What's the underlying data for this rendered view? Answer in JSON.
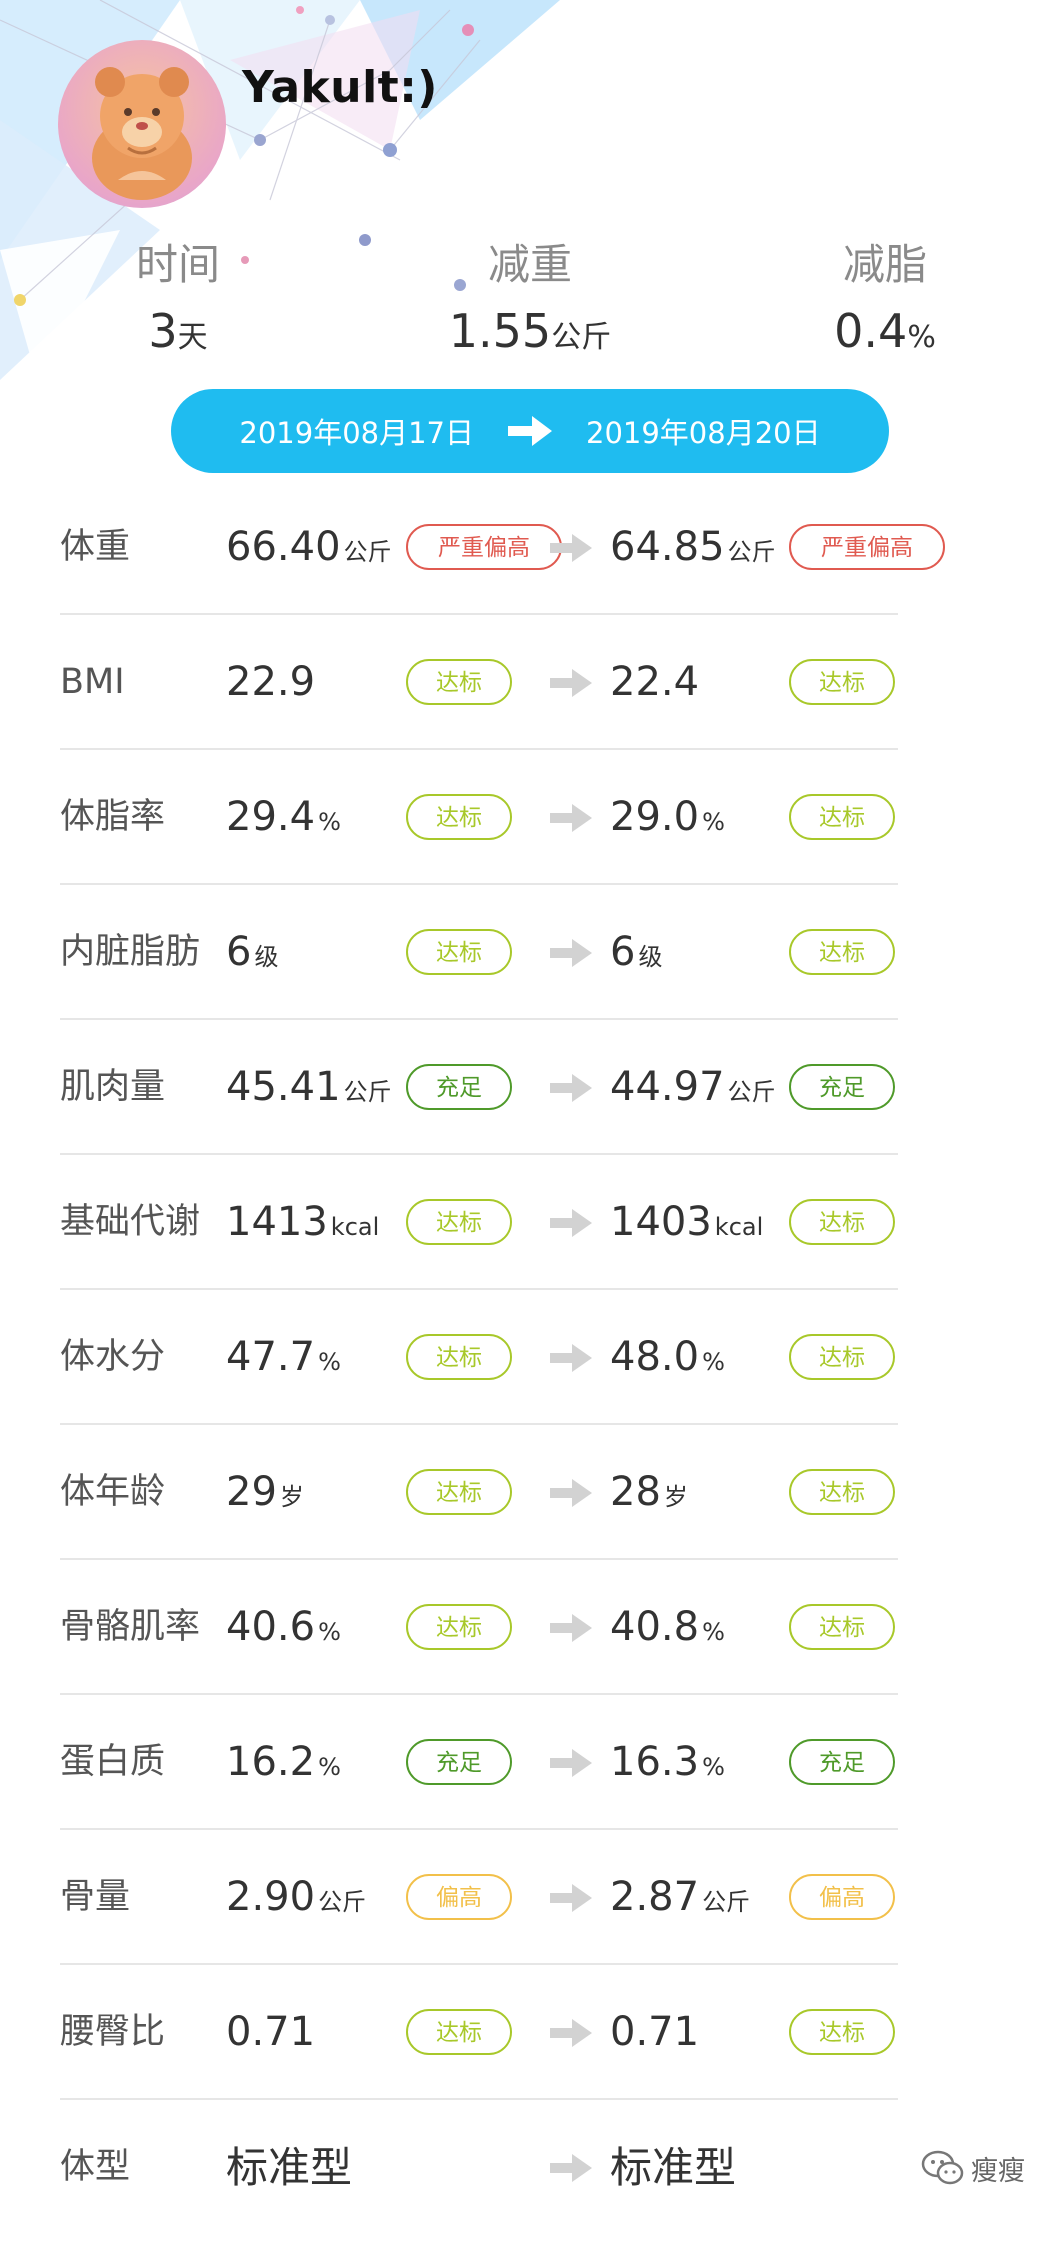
{
  "profile": {
    "username": "Yakult:)"
  },
  "summary": {
    "time_label": "时间",
    "time_value": "3",
    "time_unit": "天",
    "weight_label": "减重",
    "weight_value": "1.55",
    "weight_unit": "公斤",
    "fat_label": "减脂",
    "fat_value": "0.4",
    "fat_unit": "%"
  },
  "date_range": {
    "start": "2019年08月17日",
    "end": "2019年08月20日"
  },
  "status_colors": {
    "严重偏高": "#e05a50",
    "达标": "#a8c82a",
    "充足": "#4f9a2a",
    "偏高": "#f2c04a"
  },
  "metrics": [
    {
      "label": "体重",
      "before": "66.40",
      "before_unit": "公斤",
      "before_status": "严重偏高",
      "after": "64.85",
      "after_unit": "公斤",
      "after_status": "严重偏高"
    },
    {
      "label": "BMI",
      "before": "22.9",
      "before_unit": "",
      "before_status": "达标",
      "after": "22.4",
      "after_unit": "",
      "after_status": "达标"
    },
    {
      "label": "体脂率",
      "before": "29.4",
      "before_unit": "%",
      "before_status": "达标",
      "after": "29.0",
      "after_unit": "%",
      "after_status": "达标"
    },
    {
      "label": "内脏脂肪",
      "before": "6",
      "before_unit": "级",
      "before_status": "达标",
      "after": "6",
      "after_unit": "级",
      "after_status": "达标"
    },
    {
      "label": "肌肉量",
      "before": "45.41",
      "before_unit": "公斤",
      "before_status": "充足",
      "after": "44.97",
      "after_unit": "公斤",
      "after_status": "充足"
    },
    {
      "label": "基础代谢",
      "before": "1413",
      "before_unit": "kcal",
      "before_status": "达标",
      "after": "1403",
      "after_unit": "kcal",
      "after_status": "达标"
    },
    {
      "label": "体水分",
      "before": "47.7",
      "before_unit": "%",
      "before_status": "达标",
      "after": "48.0",
      "after_unit": "%",
      "after_status": "达标"
    },
    {
      "label": "体年龄",
      "before": "29",
      "before_unit": "岁",
      "before_status": "达标",
      "after": "28",
      "after_unit": "岁",
      "after_status": "达标"
    },
    {
      "label": "骨骼肌率",
      "before": "40.6",
      "before_unit": "%",
      "before_status": "达标",
      "after": "40.8",
      "after_unit": "%",
      "after_status": "达标"
    },
    {
      "label": "蛋白质",
      "before": "16.2",
      "before_unit": "%",
      "before_status": "充足",
      "after": "16.3",
      "after_unit": "%",
      "after_status": "充足"
    },
    {
      "label": "骨量",
      "before": "2.90",
      "before_unit": "公斤",
      "before_status": "偏高",
      "after": "2.87",
      "after_unit": "公斤",
      "after_status": "偏高"
    },
    {
      "label": "腰臀比",
      "before": "0.71",
      "before_unit": "",
      "before_status": "达标",
      "after": "0.71",
      "after_unit": "",
      "after_status": "达标"
    },
    {
      "label": "体型",
      "before": "标准型",
      "before_unit": "",
      "before_status": "",
      "after": "标准型",
      "after_unit": "",
      "after_status": ""
    }
  ],
  "watermark": {
    "icon": "wechat-icon",
    "text": "瘦瘦"
  }
}
